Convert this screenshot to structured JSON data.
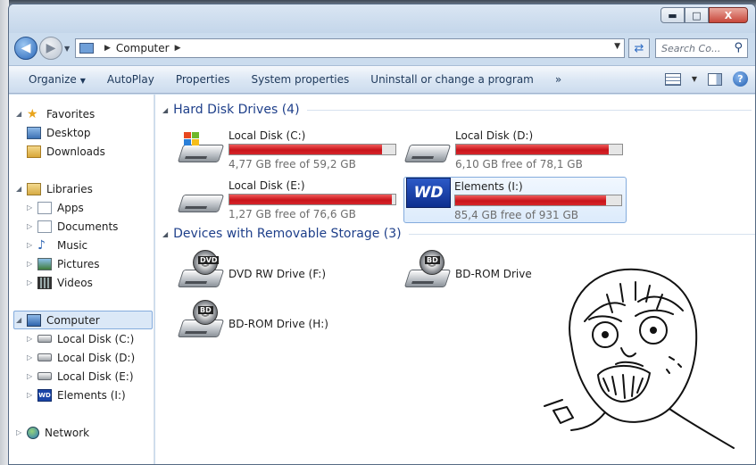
{
  "window": {
    "minimize": "▬",
    "maximize": "□",
    "close": "X"
  },
  "address": {
    "location": "Computer",
    "search_placeholder": "Search Co..."
  },
  "toolbar": {
    "organize": "Organize",
    "autoplay": "AutoPlay",
    "properties": "Properties",
    "system_properties": "System properties",
    "uninstall": "Uninstall or change a program",
    "more": "»"
  },
  "nav": {
    "favorites": "Favorites",
    "desktop": "Desktop",
    "downloads": "Downloads",
    "libraries": "Libraries",
    "apps": "Apps",
    "documents": "Documents",
    "music": "Music",
    "pictures": "Pictures",
    "videos": "Videos",
    "computer": "Computer",
    "disk_c": "Local Disk (C:)",
    "disk_d": "Local Disk (D:)",
    "disk_e": "Local Disk (E:)",
    "elements": "Elements (I:)",
    "network": "Network"
  },
  "groups": {
    "hdd": "Hard Disk Drives (4)",
    "removable": "Devices with Removable Storage (3)"
  },
  "drives": [
    {
      "name": "Local Disk (C:)",
      "free": "4,77 GB free of 59,2 GB",
      "used_fraction": 0.92
    },
    {
      "name": "Local Disk (D:)",
      "free": "6,10 GB free of 78,1 GB",
      "used_fraction": 0.92
    },
    {
      "name": "Local Disk (E:)",
      "free": "1,27 GB free of 76,6 GB",
      "used_fraction": 0.98
    },
    {
      "name": "Elements (I:)",
      "free": "85,4 GB free of 931 GB",
      "used_fraction": 0.91
    }
  ],
  "removable": [
    {
      "name": "DVD RW Drive (F:)",
      "badge": "DVD"
    },
    {
      "name": "BD-ROM Drive (G:)",
      "badge": "BD"
    },
    {
      "name": "BD-ROM Drive (H:)",
      "badge": "BD"
    }
  ],
  "wd_logo": "WD",
  "colors": {
    "bar_fill": "#c9141a",
    "selection": "#dbe8f7",
    "group_heading": "#1e3f8a"
  }
}
